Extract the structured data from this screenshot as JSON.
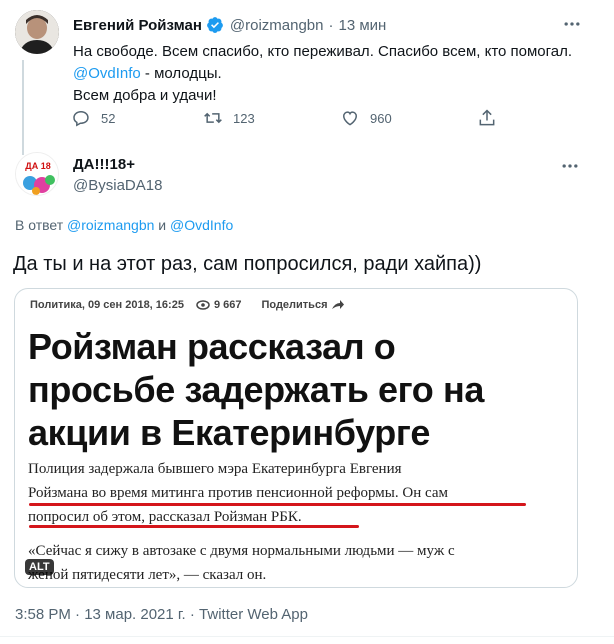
{
  "parent_tweet": {
    "display_name": "Евгений Ройзман",
    "handle": "@roizmangbn",
    "separator": "·",
    "time": "13 мин",
    "line1": "На свободе. Всем спасибо, кто переживал. Спасибо всем, кто помогал.",
    "mention": "@OvdInfo",
    "line2_rest": " - молодцы.",
    "line3": "Всем добра и удачи!",
    "reply_count": "52",
    "retweet_count": "123",
    "like_count": "960"
  },
  "reply_tweet": {
    "display_name": "ДА!!!18+",
    "handle": "@BysiaDA18",
    "avatar_text": "ДА 18",
    "reply_prefix": "В ответ",
    "reply_to_1": "@roizmangbn",
    "reply_and": "и",
    "reply_to_2": "@OvdInfo",
    "text": "Да ты и на этот раз, сам попросился, ради хайпа))",
    "footer": "3:58 PM · 13 мар. 2021 г. · Twitter Web App"
  },
  "article_image": {
    "meta_category_date": "Политика, 09 сен 2018, 16:25",
    "meta_views": "9 667",
    "meta_share": "Поделиться",
    "headline_line1": "Ройзман рассказал о",
    "headline_line2": "просьбе задержать его на",
    "headline_line3": "акции в Екатеринбурге",
    "body_line1": "Полиция задержала бывшего мэра Екатеринбурга Евгения",
    "body_line2": "Ройзмана во время митинга против пенсионной реформы. Он сам",
    "body_line3": "попросил об этом, рассказал Ройзман РБК.",
    "body_line4": "«Сейчас я сижу в автозаке с двумя нормальными людьми — муж с",
    "body_line5": "женой пятидесяти лет», — сказал он.",
    "alt_badge": "ALT"
  },
  "colors": {
    "accent": "#1d9bf0",
    "muted": "#536471",
    "verified": "#1d9bf0",
    "underline": "#d4161b"
  }
}
